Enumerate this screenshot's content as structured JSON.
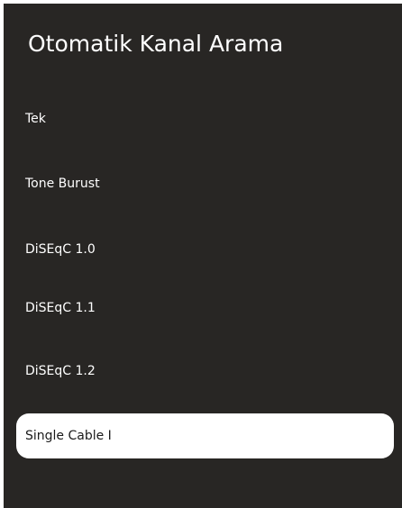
{
  "screen": {
    "title": "Otomatik Kanal Arama"
  },
  "menu": {
    "items": [
      {
        "label": "Tek",
        "selected": false
      },
      {
        "label": "Tone Burust",
        "selected": false
      },
      {
        "label": "DiSEqC 1.0",
        "selected": false
      },
      {
        "label": "DiSEqC 1.1",
        "selected": false
      },
      {
        "label": "DiSEqC 1.2",
        "selected": false
      },
      {
        "label": "Single Cable I",
        "selected": true
      }
    ]
  },
  "colors": {
    "background": "#282624",
    "text": "#ffffff",
    "selected_background": "#ffffff",
    "selected_text": "#1a1a1a"
  }
}
